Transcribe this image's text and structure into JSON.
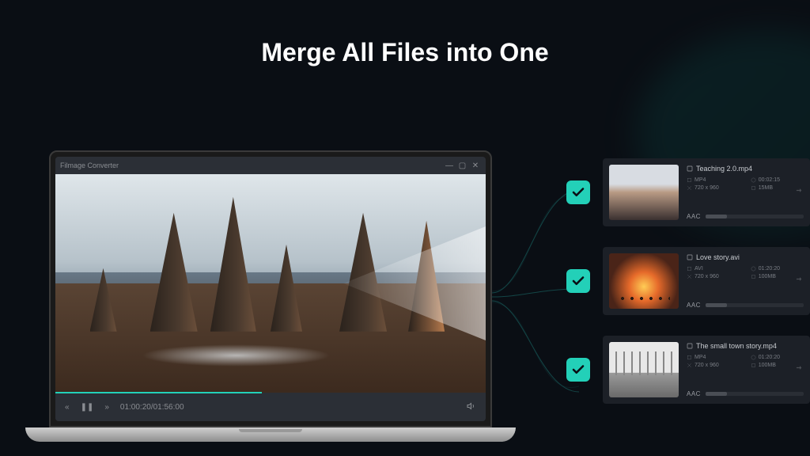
{
  "hero": {
    "title": "Merge All Files into One"
  },
  "app": {
    "window_title": "Filmage Converter",
    "timecode": "01:00:20/01:56:00"
  },
  "files": [
    {
      "checked": true,
      "title": "Teaching 2.0.mp4",
      "format": "MP4",
      "duration": "00:02:15",
      "resolution": "720 x 960",
      "size": "15MB",
      "codec": "AAC"
    },
    {
      "checked": true,
      "title": "Love story.avi",
      "format": "AVI",
      "duration": "01:20:20",
      "resolution": "720 x 960",
      "size": "100MB",
      "codec": "AAC"
    },
    {
      "checked": true,
      "title": "The small town story.mp4",
      "format": "MP4",
      "duration": "01:20:20",
      "resolution": "720 x 960",
      "size": "100MB",
      "codec": "AAC"
    }
  ],
  "window_controls": {
    "minimize": "—",
    "maximize": "▢",
    "close": "✕"
  }
}
